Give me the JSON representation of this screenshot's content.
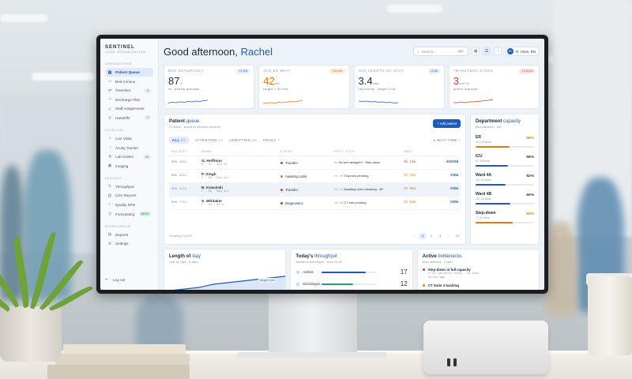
{
  "sidebar": {
    "brand": "SENTINEL",
    "brand_sub": "CASE ORGANIZATION",
    "sections": [
      {
        "title": "OPERATIONS",
        "items": [
          {
            "label": "Patient Queue",
            "icon": "queue-icon",
            "active": true
          },
          {
            "label": "Bed Census",
            "icon": "bed-icon"
          },
          {
            "label": "Transfers",
            "icon": "transfer-icon",
            "badge": "5"
          },
          {
            "label": "Discharge Plan",
            "icon": "discharge-icon"
          },
          {
            "label": "Staff Assignments",
            "icon": "staff-icon"
          },
          {
            "label": "Handoffs",
            "icon": "handoff-icon",
            "badge": "3"
          }
        ]
      },
      {
        "title": "CLINICAL",
        "items": [
          {
            "label": "Live Vitals",
            "icon": "vitals-icon"
          },
          {
            "label": "Acuity Tracker",
            "icon": "acuity-icon"
          },
          {
            "label": "Lab Orders",
            "icon": "lab-icon",
            "badge": "26"
          },
          {
            "label": "Imaging",
            "icon": "imaging-icon"
          }
        ]
      },
      {
        "title": "INSIGHT",
        "items": [
          {
            "label": "Throughput",
            "icon": "throughput-icon"
          },
          {
            "label": "LOS Reports",
            "icon": "report-icon"
          },
          {
            "label": "Quality KPIs",
            "icon": "quality-icon"
          },
          {
            "label": "Forecasting",
            "icon": "forecast-icon",
            "badge": "BETA"
          }
        ]
      },
      {
        "title": "WORKSPACE",
        "items": [
          {
            "label": "Reports",
            "icon": "reports-icon"
          },
          {
            "label": "Settings",
            "icon": "settings-icon"
          }
        ]
      }
    ],
    "logout": "Log out"
  },
  "header": {
    "greeting": "Good afternoon,",
    "name": "Rachel",
    "search_placeholder": "Search...",
    "search_kbd": "⌘K",
    "user_initials": "RC",
    "user_name": "R. Chen, RN"
  },
  "kpis": [
    {
      "label": "BED OCCUPANCY",
      "delta": "+1.2%",
      "value": "87",
      "unit": "%",
      "sub": "vs. weekly average",
      "color": "#1e5bb8",
      "kind": "blue"
    },
    {
      "label": "AVG ER WAIT",
      "delta": "+12 min",
      "value": "42",
      "unit": "min",
      "sub": "target < 30 min",
      "color": "#e07a12",
      "kind": "warn"
    },
    {
      "label": "AVG LENGTH OF STAY",
      "delta": "-0.3d",
      "value": "3.4",
      "unit": "days",
      "sub": "improving · target 3.0d",
      "color": "#1e5bb8",
      "kind": "blue"
    },
    {
      "label": "TRANSFERS STUCK",
      "delta": "+2 in 1h",
      "value": "3",
      "unit": "over 2h",
      "sub": "action required",
      "color": "#d9392b",
      "kind": "bad"
    }
  ],
  "queue": {
    "title": "Patient",
    "title_accent": "queue",
    "subtitle": "97 active · sorted by attention required",
    "add_button": "+ Add patient",
    "tabs": [
      {
        "label": "ALL",
        "count": "97",
        "active": true
      },
      {
        "label": "ATTENTION",
        "count": "12"
      },
      {
        "label": "ADMITTING",
        "count": "36"
      },
      {
        "label": "READY",
        "count": "7"
      }
    ],
    "sort_label": "▾ WAIT TIME ↓",
    "columns": [
      "PATIENT",
      "NAME",
      "STAGE",
      "NEXT STEP",
      "WAIT",
      ""
    ],
    "rows": [
      {
        "mrn": "MRN 4401",
        "name": "G. Hoffman",
        "meta": "M · 71 · ICU 12",
        "stage": "Transfer",
        "stage_color": "#d9392b",
        "step_time": "8m",
        "step": "No bed assigned · Step-down",
        "wait": "4h 12m",
        "wait_color": "#d9392b",
        "action": "ASSIGN"
      },
      {
        "mrn": "MRN 9312",
        "name": "P. Singh",
        "meta": "F · 58 · Obs 3rd",
        "stage": "Awaiting Labs",
        "stage_color": "#e07a12",
        "step_time": "25:58",
        "step": "Troponin pending",
        "wait": "3h 47m",
        "wait_color": "#e07a12",
        "action": "VIEW"
      },
      {
        "mrn": "MRN 4419",
        "name": "B. Kowalski",
        "meta": "F · 66 · Med 3rd",
        "stage": "Transfer",
        "stage_color": "#d9392b",
        "step_time": "14:42",
        "step": "Awaiting room cleaning · 4E",
        "wait": "3h 05m",
        "wait_color": "#e07a12",
        "action": "VIEW",
        "selected": true
      },
      {
        "mrn": "MRN 7712",
        "name": "S. Whitaker",
        "meta": "F · 44 · ED 3",
        "stage": "Diagnostics",
        "stage_color": "#d9392b",
        "step_time": "14:06",
        "step": "CT slot pending",
        "wait": "2h 51m",
        "wait_color": "#e07a12",
        "action": "VIEW"
      }
    ],
    "footer": "Showing 10 of 97",
    "pages": [
      "1",
      "2",
      "3",
      "…",
      "10"
    ]
  },
  "dept": {
    "title": "Department",
    "title_accent": "capacity",
    "subtitle": "Bed utilization · live",
    "wards": [
      {
        "name": "ER",
        "beds": "14 / 24 beds",
        "pct": "58%",
        "value": 58,
        "color": "#e07a12",
        "orange": true
      },
      {
        "name": "ICU",
        "beds": "9 / 16 beds",
        "pct": "56%",
        "value": 56,
        "color": "#1e5bb8"
      },
      {
        "name": "Ward 4A",
        "beds": "16 / 31 beds",
        "pct": "52%",
        "value": 52,
        "color": "#1e5bb8"
      },
      {
        "name": "Ward 4B",
        "beds": "15 / 25 beds",
        "pct": "60%",
        "value": 60,
        "color": "#1e5bb8"
      },
      {
        "name": "Step-down",
        "beds": "7 / 11 beds",
        "pct": "63%",
        "value": 63,
        "color": "#e07a12",
        "orange": true
      }
    ]
  },
  "los": {
    "title": "Length of",
    "title_accent": "stay",
    "subtitle": "Last 14 days · in days",
    "target": "target 3.0d",
    "chart_data": {
      "type": "area",
      "values": [
        2.4,
        2.5,
        2.6,
        2.8,
        2.9,
        3.0,
        3.1,
        3.2,
        3.3,
        3.4
      ]
    }
  },
  "throughput": {
    "title": "Today's",
    "title_accent": "throughput",
    "subtitle": "Admits vs discharges · since 00:00",
    "rows": [
      {
        "label": "Admits",
        "count": "17",
        "value": 0.8,
        "color": "#1e5bb8",
        "icon": "+"
      },
      {
        "label": "Discharges",
        "count": "12",
        "value": 0.57,
        "color": "#2a9d66",
        "icon": "−"
      }
    ]
  },
  "bottlenecks": {
    "title": "Active",
    "title_accent": "bottlenecks",
    "subtitle": "Auto-detected · 3 open",
    "items": [
      {
        "title": "Step-down at full capacity",
        "sub": "3 ICU patients ready · no beds",
        "time": "42 min ago"
      },
      {
        "title": "CT Suite 3 backlog",
        "sub": "",
        "time": ""
      }
    ]
  }
}
